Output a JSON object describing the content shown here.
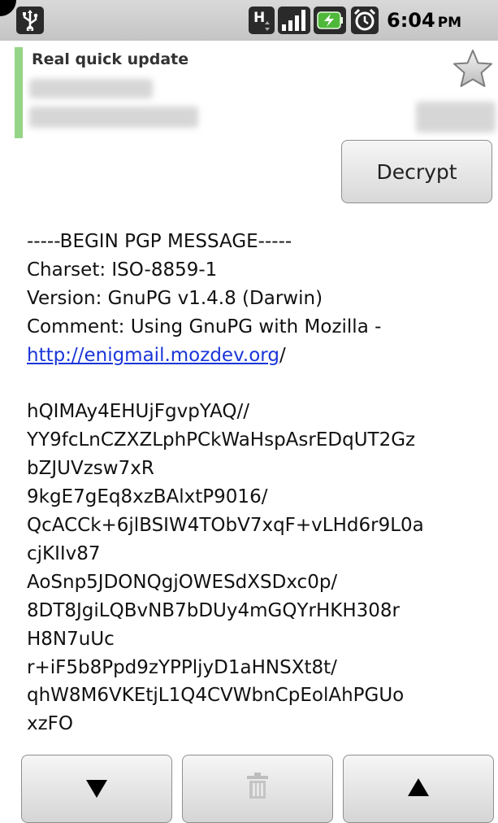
{
  "status_bar": {
    "time": "6:04",
    "ampm": "PM",
    "icons": [
      "usb-debug-icon",
      "hplus-network-icon",
      "signal-bars-icon",
      "battery-charging-icon",
      "alarm-clock-icon"
    ]
  },
  "header": {
    "subject": "Real quick update",
    "starred": false,
    "accent_color": "#95d587"
  },
  "actions": {
    "decrypt_label": "Decrypt"
  },
  "message": {
    "lines": [
      "-----BEGIN PGP MESSAGE-----",
      "Charset: ISO-8859-1",
      "Version: GnuPG v1.4.8 (Darwin)",
      "Comment: Using GnuPG with Mozilla -"
    ],
    "link_text": "http://enigmail.mozdev.org",
    "link_suffix": "/",
    "cipher_lines": [
      "hQIMAy4EHUjFgvpYAQ//",
      "YY9fcLnCZXZLphPCkWaHspAsrEDqUT2Gz",
      "bZJUVzsw7xR",
      "9kgE7gEq8xzBAlxtP9016/",
      "QcACCk+6jlBSIW4TObV7xqF+vLHd6r9L0a",
      "cjKIIv87",
      "AoSnp5JDONQgjOWESdXSDxc0p/",
      "8DT8JgiLQBvNB7bDUy4mGQYrHKH308r",
      "H8N7uUc",
      "r+iF5b8Ppd9zYPPljyD1aHNSXt8t/",
      "qhW8M6VKEtjL1Q4CVWbnCpEolAhPGUo",
      "xzFO"
    ]
  },
  "toolbar": {
    "prev_icon": "arrow-down-icon",
    "delete_icon": "trash-icon",
    "next_icon": "arrow-up-icon"
  }
}
